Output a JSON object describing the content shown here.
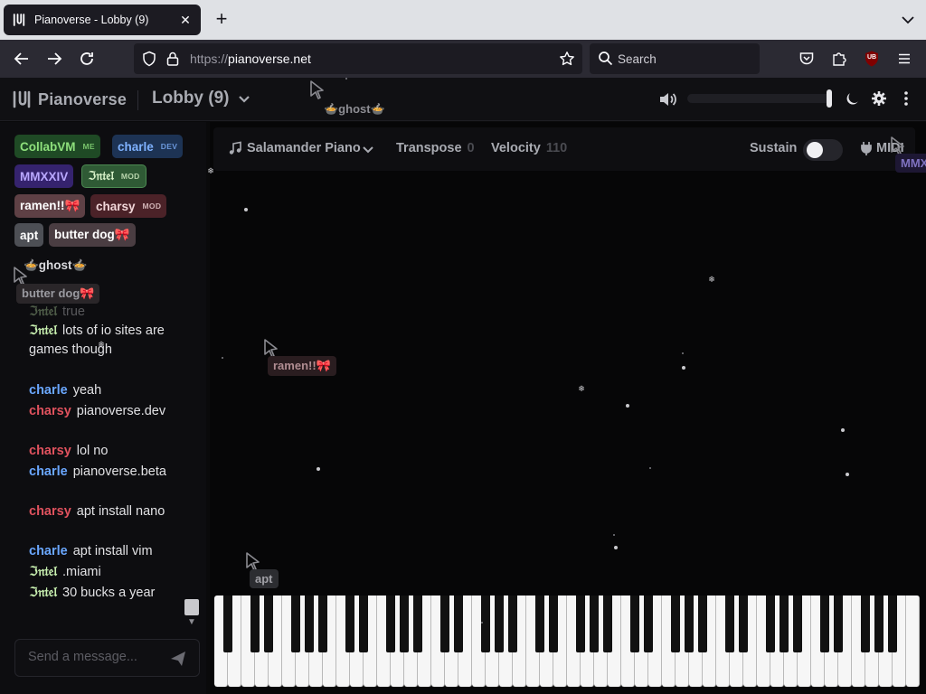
{
  "browser": {
    "tab_title": "Pianoverse - Lobby (9)",
    "url_prefix": "https://",
    "url_host": "pianoverse.net",
    "search_placeholder": "Search",
    "extension_badge": "UB"
  },
  "header": {
    "logo_text": "Pianoverse",
    "room_title": "Lobby (9)",
    "volume_level": 1.0
  },
  "users": [
    {
      "name": "CollabVM",
      "tag": "ME",
      "color": "#8ee07c",
      "bg": "#1f4a25"
    },
    {
      "name": "charle",
      "tag": "DEV",
      "color": "#7fb2ff",
      "bg": "#1d3354"
    },
    {
      "name": "MMXXIV",
      "tag": "",
      "color": "#b9a8ff",
      "bg": "#35236e"
    },
    {
      "name": "ℑ𝔫𝔱𝔢𝔩",
      "tag": "MOD",
      "color": "#d9f2c9",
      "bg": "#2f5a35"
    },
    {
      "name": "ramen!!🎀",
      "tag": "",
      "color": "#ffffff",
      "bg": "#5e4045"
    },
    {
      "name": "charsy",
      "tag": "MOD",
      "color": "#f0d6d8",
      "bg": "#4b2228"
    },
    {
      "name": "apt",
      "tag": "",
      "color": "#ffffff",
      "bg": "#4d4f55"
    },
    {
      "name": "butter dog🎀",
      "tag": "",
      "color": "#ffffff",
      "bg": "#4a3d42"
    },
    {
      "name": "🍲ghost🍲",
      "tag": "",
      "color": "#d9d9dd",
      "bg": "transparent"
    }
  ],
  "chat": {
    "placeholder": "Send a message...",
    "messages": [
      {
        "name": "ℑ𝔫𝔱𝔢𝔩",
        "text": "true",
        "color": "#c8f0b0"
      },
      {
        "name": "ℑ𝔫𝔱𝔢𝔩",
        "text": "lots of io sites are games though",
        "color": "#c8f0b0"
      },
      {
        "name": "charle",
        "text": "yeah",
        "color": "#6aa7ff"
      },
      {
        "name": "charsy",
        "text": "pianoverse.dev",
        "color": "#e0525e"
      },
      {
        "name": "charsy",
        "text": "lol no",
        "color": "#e0525e"
      },
      {
        "name": "charle",
        "text": "pianoverse.beta",
        "color": "#6aa7ff"
      },
      {
        "name": "charsy",
        "text": "apt install nano",
        "color": "#e0525e"
      },
      {
        "name": "charle",
        "text": "apt install vim",
        "color": "#6aa7ff"
      },
      {
        "name": "ℑ𝔫𝔱𝔢𝔩",
        "text": ".miami",
        "color": "#c8f0b0"
      },
      {
        "name": "ℑ𝔫𝔱𝔢𝔩",
        "text": "30 bucks a year",
        "color": "#c8f0b0"
      }
    ]
  },
  "toolbar": {
    "instrument": "Salamander Piano",
    "transpose_label": "Transpose",
    "transpose_value": "0",
    "velocity_label": "Velocity",
    "velocity_value": "110",
    "sustain_label": "Sustain",
    "sustain_on": false,
    "midi_label": "MIDI"
  },
  "cursor_labels": [
    {
      "text": "🍲ghost🍲",
      "color": "#8e8e94",
      "bg": "transparent"
    },
    {
      "text": "butter dog🎀",
      "color": "#9a9aa0",
      "bg": "#2a2629"
    },
    {
      "text": "ramen!!🎀",
      "color": "#b08d92",
      "bg": "#2a1d20"
    },
    {
      "text": "apt",
      "color": "#a0a0a6",
      "bg": "#2c2d31"
    },
    {
      "text": "MMX",
      "color": "#7f72c0",
      "bg": "#1d1733"
    }
  ],
  "colors": {
    "accent_text": "#a9abb2",
    "background": "#0a0a0b"
  }
}
